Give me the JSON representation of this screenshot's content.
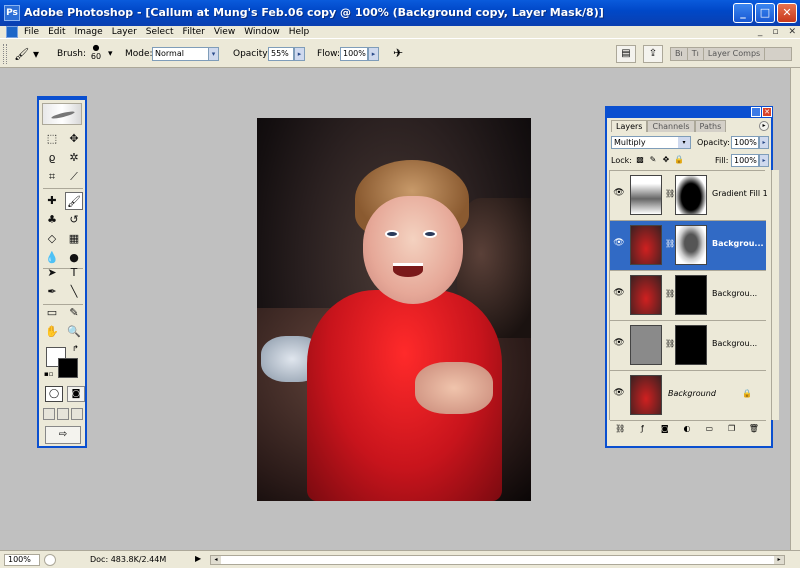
{
  "window": {
    "title": "Adobe Photoshop - [Callum at Mung's Feb.06 copy @ 100% (Background copy, Layer Mask/8)]",
    "minimize_label": "_",
    "maximize_label": "□",
    "close_label": "✕"
  },
  "menu": {
    "items": [
      "File",
      "Edit",
      "Image",
      "Layer",
      "Select",
      "Filter",
      "View",
      "Window",
      "Help"
    ],
    "mdi": [
      "_",
      "▫",
      "✕"
    ]
  },
  "options": {
    "brush_label": "Brush:",
    "brush_size": "60",
    "mode_label": "Mode:",
    "mode_value": "Normal",
    "opacity_label": "Opacity:",
    "opacity_value": "55%",
    "flow_label": "Flow:",
    "flow_value": "100%",
    "palette_tabs": [
      "Bı",
      "Tı",
      "Layer Comps"
    ]
  },
  "layers_palette": {
    "tabs": [
      "Layers",
      "Channels",
      "Paths"
    ],
    "blend_mode": "Multiply",
    "opacity_label": "Opacity:",
    "opacity_value": "100%",
    "lock_label": "Lock:",
    "fill_label": "Fill:",
    "fill_value": "100%",
    "layers": [
      {
        "name": "Gradient Fill 1",
        "selected": false
      },
      {
        "name": "Backgrou...",
        "selected": true
      },
      {
        "name": "Backgrou...",
        "selected": false
      },
      {
        "name": "Backgrou...",
        "selected": false
      },
      {
        "name": "Background",
        "selected": false
      }
    ]
  },
  "status": {
    "zoom": "100%",
    "doc": "Doc: 483.8K/2.44M"
  },
  "colors": {
    "title_bar": "#0a5bdc",
    "selection": "#316ac5",
    "workspace": "#c0c0c0"
  }
}
